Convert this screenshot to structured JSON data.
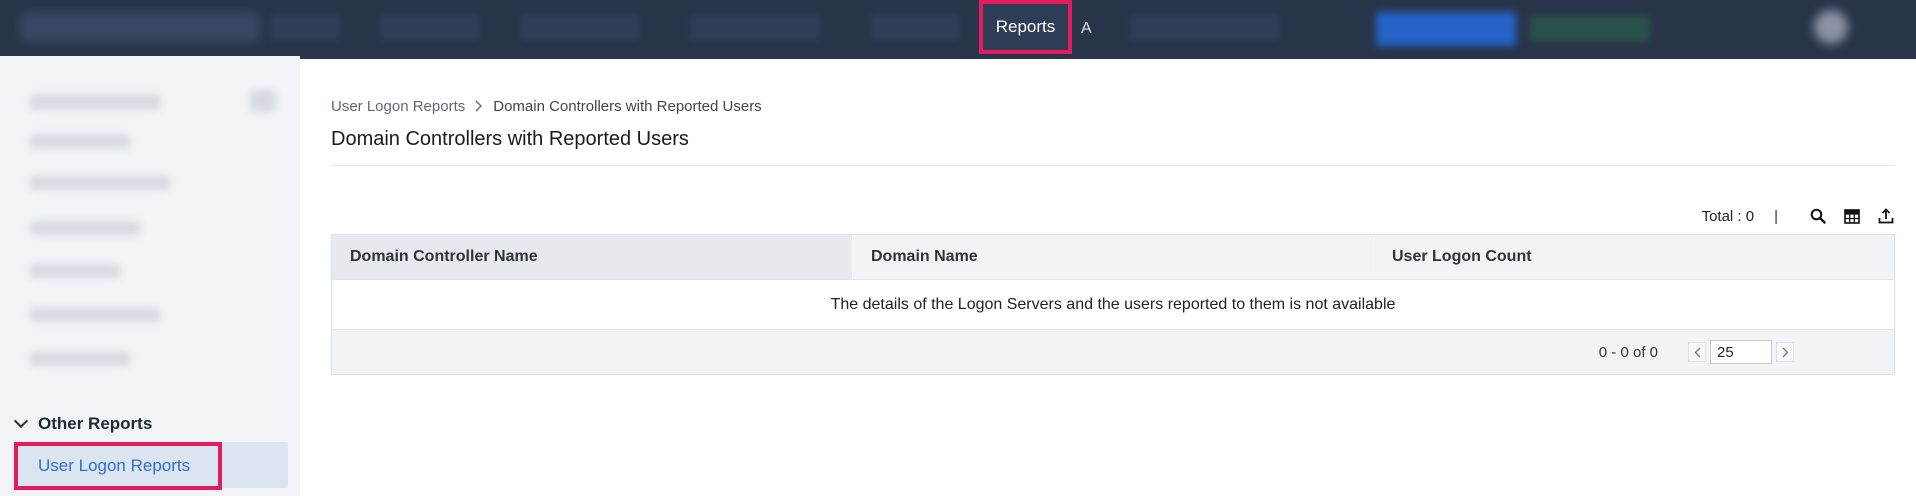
{
  "topbar": {
    "active_tab": "Reports",
    "next_tab_partial": "A"
  },
  "sidebar": {
    "section_title": "Other Reports",
    "items": [
      {
        "label": "User Logon Reports",
        "selected": true
      }
    ]
  },
  "breadcrumb": {
    "parent": "User Logon Reports",
    "current": "Domain Controllers with Reported Users"
  },
  "page": {
    "title": "Domain Controllers with Reported Users"
  },
  "toolbar": {
    "total_label": "Total : 0",
    "separator": "|",
    "icons": [
      "search-icon",
      "table-columns-icon",
      "export-icon"
    ]
  },
  "grid": {
    "columns": [
      "Domain Controller Name",
      "Domain Name",
      "User Logon Count"
    ],
    "empty_message": "The details of the Logon Servers and the users reported to them is not available",
    "range_text": "0 - 0 of 0",
    "page_size": "25"
  },
  "colors": {
    "topbar_bg": "#28344a",
    "highlight": "#e31c5f",
    "link_blue": "#2f6fd0",
    "sidebar_bg": "#f2f4f7"
  }
}
